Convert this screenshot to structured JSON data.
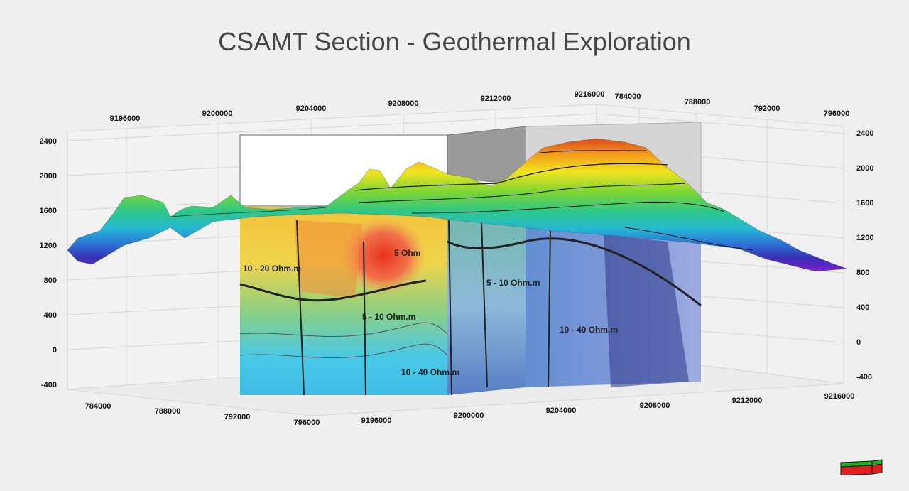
{
  "title": "CSAMT Section - Geothermal Exploration",
  "axes": {
    "top_northing": [
      "9196000",
      "9200000",
      "9204000",
      "9208000",
      "9212000",
      "9216000"
    ],
    "top_easting": [
      "784000",
      "788000",
      "792000",
      "796000"
    ],
    "left_elevation": [
      "2400",
      "2000",
      "1600",
      "1200",
      "800",
      "400",
      "0",
      "-400"
    ],
    "right_elevation": [
      "2400",
      "2000",
      "1600",
      "1200",
      "800",
      "400",
      "0",
      "-400"
    ],
    "bottom_easting": [
      "784000",
      "788000",
      "792000",
      "796000"
    ],
    "bottom_northing": [
      "9196000",
      "9200000",
      "9204000",
      "9208000",
      "9212000",
      "9216000"
    ]
  },
  "section_labels": [
    "10 - 20 Ohm.m",
    "5 - 10 Ohm.m",
    "10 - 40 Ohm.m",
    "5 - 10 Ohm.m",
    "10 - 40 Ohm.m",
    "5 Ohm"
  ],
  "colors": {
    "background": "#efefef",
    "grid": "#d4d4d4",
    "title": "#444444"
  },
  "widget": {
    "name": "orientation-cube"
  }
}
